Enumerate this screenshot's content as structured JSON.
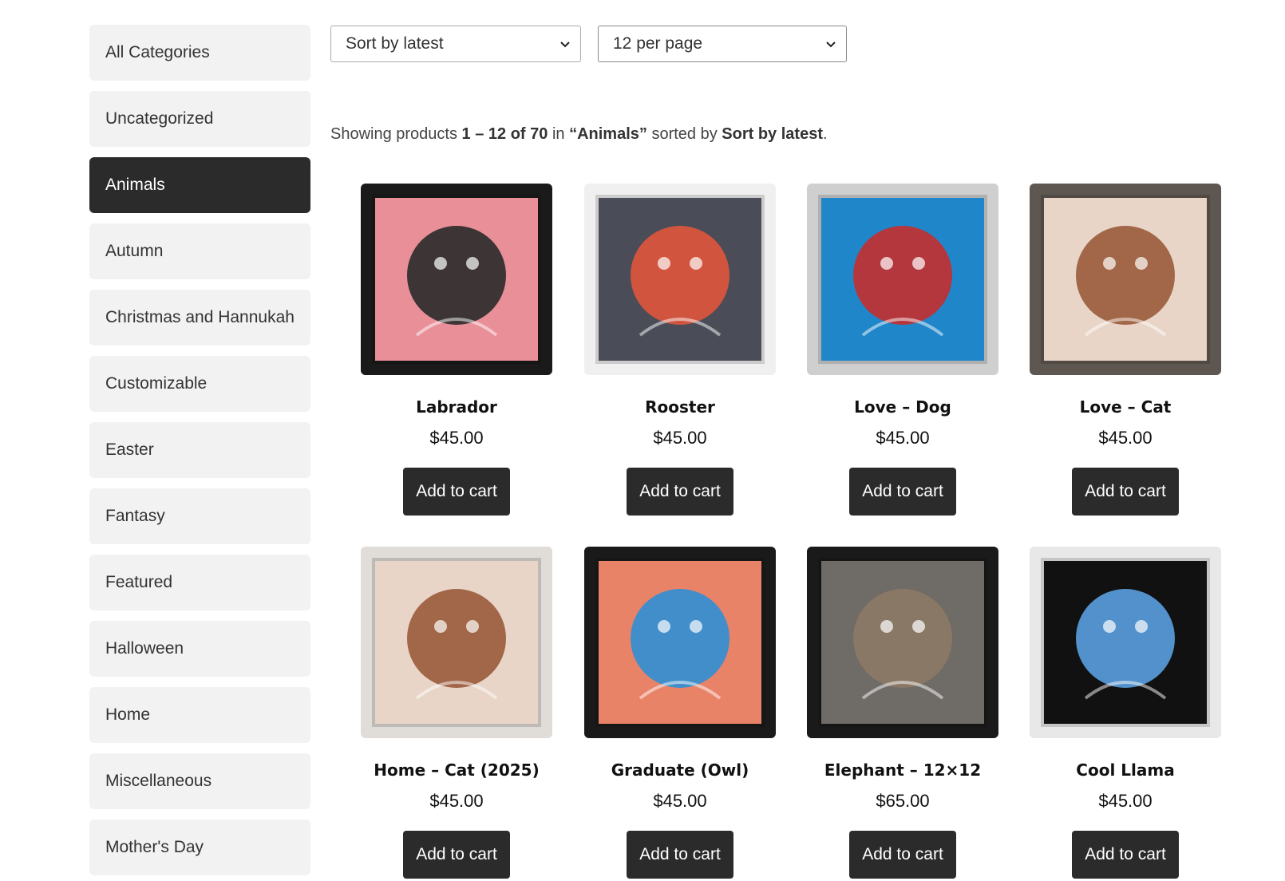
{
  "sidebar": {
    "items": [
      {
        "label": "All Categories",
        "active": false
      },
      {
        "label": "Uncategorized",
        "active": false
      },
      {
        "label": "Animals",
        "active": true
      },
      {
        "label": "Autumn",
        "active": false
      },
      {
        "label": "Christmas and Hannukah",
        "active": false
      },
      {
        "label": "Customizable",
        "active": false
      },
      {
        "label": "Easter",
        "active": false
      },
      {
        "label": "Fantasy",
        "active": false
      },
      {
        "label": "Featured",
        "active": false
      },
      {
        "label": "Halloween",
        "active": false
      },
      {
        "label": "Home",
        "active": false
      },
      {
        "label": "Miscellaneous",
        "active": false
      },
      {
        "label": "Mother's Day",
        "active": false
      }
    ]
  },
  "toolbar": {
    "sort_value": "Sort by latest",
    "per_page_value": "12 per page"
  },
  "result_count": {
    "prefix": "Showing products ",
    "range": "1 – 12 of 70",
    "mid1": " in ",
    "category": "“Animals”",
    "mid2": " sorted by ",
    "sort": "Sort by latest",
    "suffix": "."
  },
  "products": [
    {
      "name": "Labrador",
      "price": "$45.00",
      "button": "Add to cart",
      "frame": "#1a1a1a",
      "mat": "#e98f98",
      "art": "#2a2a2a",
      "icon": "labrador-artwork"
    },
    {
      "name": "Rooster",
      "price": "$45.00",
      "button": "Add to cart",
      "frame": "#f0f0f0",
      "mat": "#4a4d57",
      "art": "#e0553c",
      "icon": "rooster-artwork"
    },
    {
      "name": "Love – Dog",
      "price": "$45.00",
      "button": "Add to cart",
      "frame": "#cfcfcf",
      "mat": "#1f86c9",
      "art": "#c42f2f",
      "icon": "love-dog-artwork"
    },
    {
      "name": "Love – Cat",
      "price": "$45.00",
      "button": "Add to cart",
      "frame": "#5e5650",
      "mat": "#e8d5c8",
      "art": "#9a5a3a",
      "icon": "love-cat-artwork"
    },
    {
      "name": "Home – Cat (2025)",
      "price": "$45.00",
      "button": "Add to cart",
      "frame": "#e0dcd8",
      "mat": "#e8d5c8",
      "art": "#9a5a3a",
      "icon": "home-cat-artwork"
    },
    {
      "name": "Graduate (Owl)",
      "price": "$45.00",
      "button": "Add to cart",
      "frame": "#1a1a1a",
      "mat": "#e98368",
      "art": "#2f8fd6",
      "icon": "graduate-owl-artwork"
    },
    {
      "name": "Elephant – 12×12",
      "price": "$65.00",
      "button": "Add to cart",
      "frame": "#1a1a1a",
      "mat": "#6f6b66",
      "art": "#8d7a66",
      "icon": "elephant-artwork"
    },
    {
      "name": "Cool Llama",
      "price": "$45.00",
      "button": "Add to cart",
      "frame": "#e8e8e8",
      "mat": "#111111",
      "art": "#5aa0e0",
      "icon": "cool-llama-artwork"
    }
  ]
}
